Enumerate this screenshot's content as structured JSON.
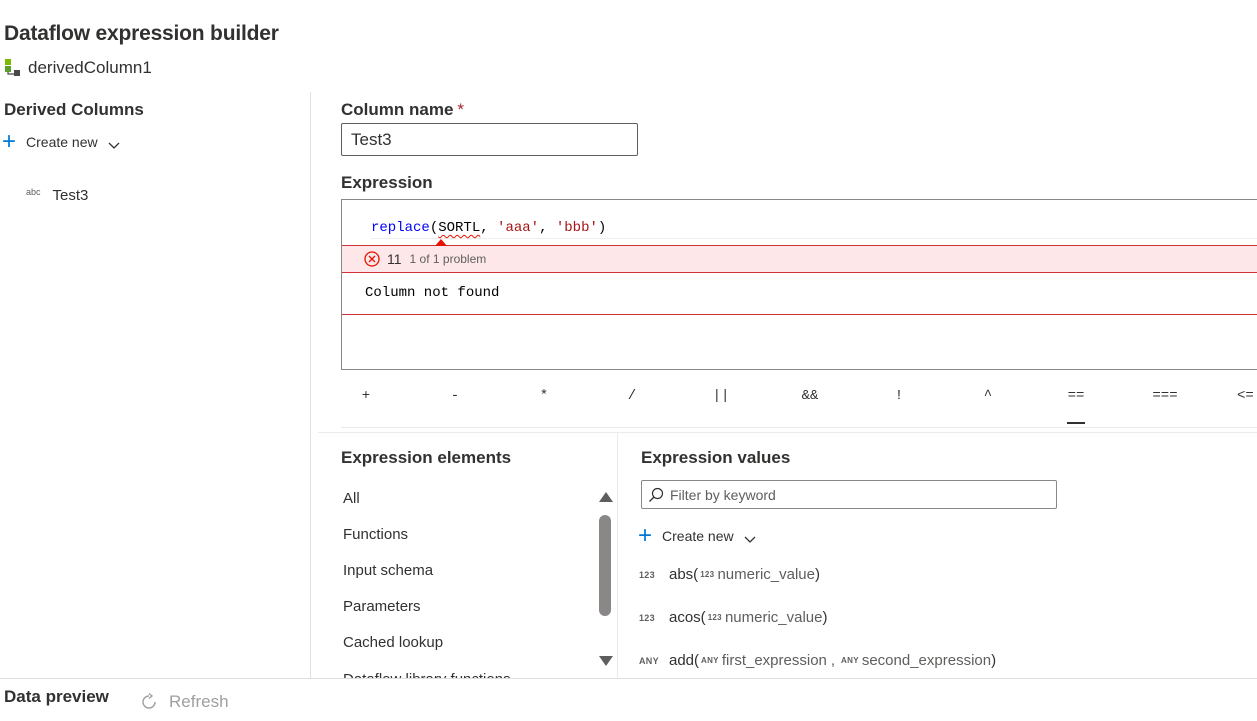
{
  "header": {
    "title": "Dataflow expression builder",
    "subtitle": "derivedColumn1"
  },
  "left_pane": {
    "heading": "Derived Columns",
    "create_new_label": "Create new",
    "columns": [
      {
        "type": "abc",
        "name": "Test3"
      }
    ]
  },
  "column_name": {
    "label": "Column name",
    "required_mark": "*",
    "value": "Test3"
  },
  "expression": {
    "label": "Expression",
    "tokens": {
      "fn": "replace",
      "open": "(",
      "ident": "SORTL",
      "sep1": ", ",
      "str1": "'aaa'",
      "sep2": ", ",
      "str2": "'bbb'",
      "close": ")"
    },
    "problem": {
      "code": "11",
      "count": "1 of 1 problem",
      "message": "Column not found"
    }
  },
  "operators": [
    "+",
    "-",
    "*",
    "/",
    "||",
    "&&",
    "!",
    "^",
    "==",
    "===",
    "<="
  ],
  "selected_operator": "==",
  "expression_elements": {
    "label": "Expression elements",
    "items": [
      "All",
      "Functions",
      "Input schema",
      "Parameters",
      "Cached lookup",
      "Dataflow library functions"
    ]
  },
  "expression_values": {
    "label": "Expression values",
    "filter_placeholder": "Filter by keyword",
    "create_new_label": "Create new",
    "functions": [
      {
        "ret": "123",
        "name": "abs(",
        "params": [
          {
            "type": "123",
            "name": "numeric_value"
          }
        ],
        "close": ")"
      },
      {
        "ret": "123",
        "name": "acos(",
        "params": [
          {
            "type": "123",
            "name": "numeric_value"
          }
        ],
        "close": ")"
      },
      {
        "ret": "ANY",
        "name": "add(",
        "params": [
          {
            "type": "ANY",
            "name": "first_expression"
          },
          {
            "type": "ANY",
            "name": "second_expression"
          }
        ],
        "separator": ",",
        "close": ")"
      }
    ]
  },
  "bottom": {
    "preview_label": "Data preview",
    "refresh_label": "Refresh"
  },
  "colors": {
    "accent": "#0078d4",
    "error": "#d13438",
    "error_bg": "#fde7e9"
  }
}
